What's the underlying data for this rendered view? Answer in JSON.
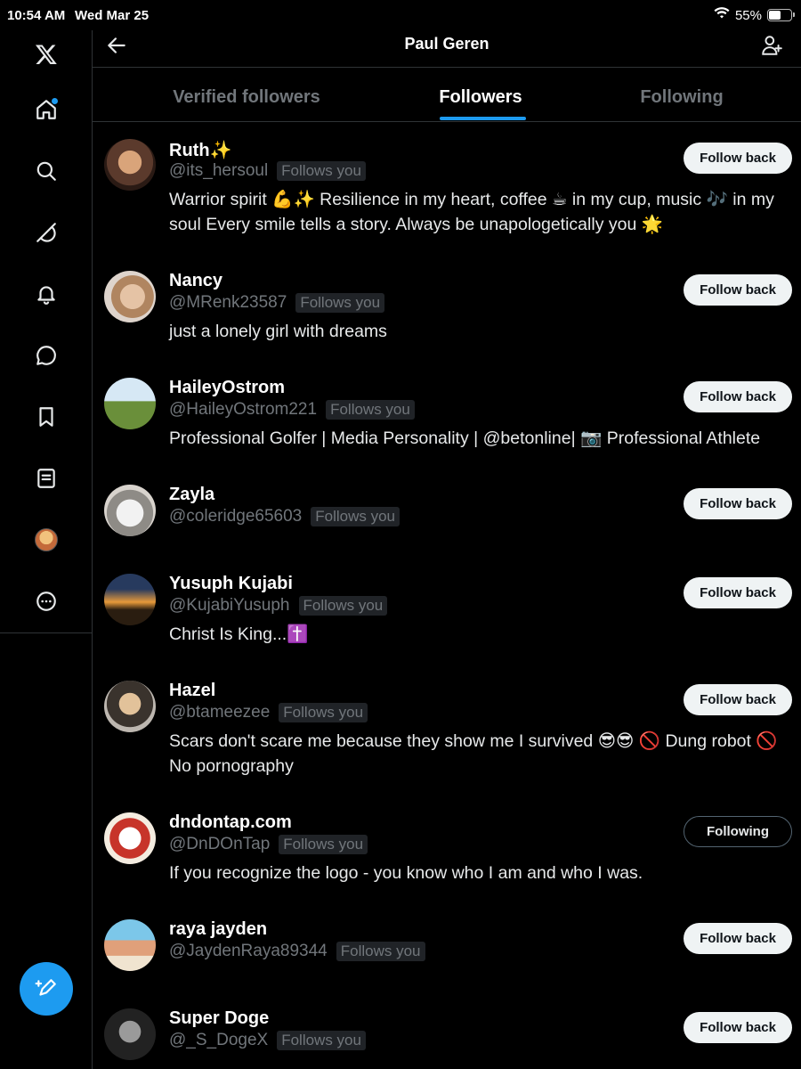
{
  "status_bar": {
    "time": "10:54 AM",
    "date": "Wed Mar 25",
    "battery": "55%",
    "battery_level": 0.55
  },
  "sidebar": {
    "items": [
      {
        "icon": "x-logo-icon"
      },
      {
        "icon": "home-icon",
        "has_notification_dot": true
      },
      {
        "icon": "search-icon"
      },
      {
        "icon": "grok-icon"
      },
      {
        "icon": "bell-icon"
      },
      {
        "icon": "chat-icon"
      },
      {
        "icon": "bookmark-icon"
      },
      {
        "icon": "lists-icon"
      },
      {
        "icon": "profile-avatar"
      },
      {
        "icon": "more-icon"
      }
    ],
    "compose_icon": "compose-icon"
  },
  "header": {
    "title": "Paul Geren",
    "back_icon": "arrow-left-icon",
    "action_icon": "add-person-icon"
  },
  "tabs": [
    {
      "label": "Verified followers",
      "active": false
    },
    {
      "label": "Followers",
      "active": true
    },
    {
      "label": "Following",
      "active": false
    }
  ],
  "accent_color": "#1d9bf0",
  "follows_you_label": "Follows you",
  "users": [
    {
      "name": "Ruth✨",
      "handle": "@its_hersoul",
      "follows_you": true,
      "bio": "Warrior spirit 💪✨ Resilience in my heart, coffee ☕ in my cup, music 🎶 in my soul Every smile tells a story. Always be unapologetically you 🌟",
      "button": "Follow back"
    },
    {
      "name": "Nancy",
      "handle": "@MRenk23587",
      "follows_you": true,
      "bio": "just a lonely girl with dreams",
      "button": "Follow back"
    },
    {
      "name": "HaileyOstrom",
      "handle": "@HaileyOstrom221",
      "follows_you": true,
      "bio": "Professional Golfer | Media Personality | @betonline| 📷 Professional Athlete",
      "button": "Follow back"
    },
    {
      "name": "Zayla",
      "handle": "@coleridge65603",
      "follows_you": true,
      "bio": "",
      "button": "Follow back"
    },
    {
      "name": "Yusuph Kujabi",
      "handle": "@KujabiYusuph",
      "follows_you": true,
      "bio": "Christ Is King...✝️",
      "button": "Follow back"
    },
    {
      "name": "Hazel",
      "handle": "@btameezee",
      "follows_you": true,
      "bio": "Scars don't scare me because they show me I survived 😎😎 🚫 Dung robot 🚫 No pornography",
      "button": "Follow back"
    },
    {
      "name": "dndontap.com",
      "handle": "@DnDOnTap",
      "follows_you": true,
      "bio": "If you recognize the logo - you know who I am and who I was.",
      "button": "Following"
    },
    {
      "name": "raya jayden",
      "handle": "@JaydenRaya89344",
      "follows_you": true,
      "bio": "",
      "button": "Follow back"
    },
    {
      "name": "Super Doge",
      "handle": "@_S_DogeX",
      "follows_you": true,
      "bio": "",
      "button": "Follow back"
    }
  ]
}
